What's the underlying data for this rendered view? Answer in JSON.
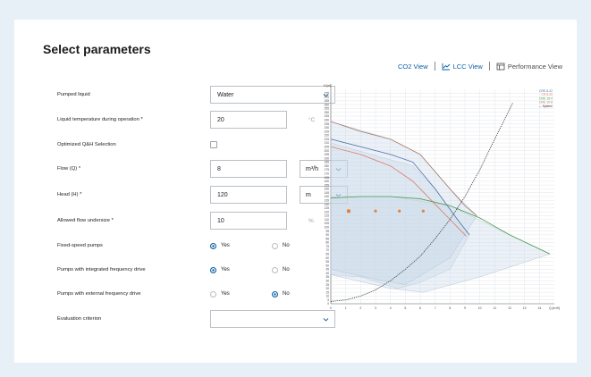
{
  "page": {
    "title": "Select parameters"
  },
  "views": [
    {
      "label": "CO2 View",
      "icon": ""
    },
    {
      "label": "LCC View",
      "icon": "line-chart-icon"
    },
    {
      "label": "Performance View",
      "icon": "performance-icon"
    }
  ],
  "form": {
    "pumped_liquid": {
      "label": "Pumped liquid",
      "value": "Water"
    },
    "liquid_temp": {
      "label": "Liquid temperature during operation *",
      "value": "20",
      "unit": "°C"
    },
    "optimized": {
      "label": "Optimized Q&H Selection",
      "checked": false
    },
    "flow": {
      "label": "Flow (Q) *",
      "value": "8",
      "unit": "m³/h"
    },
    "head": {
      "label": "Head (H) *",
      "value": "120",
      "unit": "m"
    },
    "undersize": {
      "label": "Allowed flow undersize *",
      "value": "10",
      "unit": "%"
    },
    "fixed_speed": {
      "label": "Fixed-speed pumps",
      "yes": "Yes",
      "no": "No",
      "selected": "Yes"
    },
    "integrated_freq": {
      "label": "Pumps with integrated frequency drive",
      "yes": "Yes",
      "no": "No",
      "selected": "Yes"
    },
    "external_freq": {
      "label": "Pumps with external frequency drive",
      "yes": "Yes",
      "no": "No",
      "selected": "No"
    },
    "evaluation": {
      "label": "Evaluation criterion",
      "value": ""
    }
  },
  "colors": {
    "accent": "#0b5fa5",
    "background": "#e8f0f7"
  },
  "chart_data": {
    "type": "line",
    "xlabel": "Q [m³/h]",
    "ylabel": "H [m]",
    "xlim": [
      0,
      15
    ],
    "ylim": [
      0,
      280
    ],
    "x_ticks": [
      0,
      1,
      2,
      3,
      4,
      5,
      6,
      7,
      8,
      9,
      10,
      11,
      12,
      13,
      14
    ],
    "y_ticks": [
      0,
      5,
      10,
      15,
      20,
      25,
      30,
      35,
      40,
      45,
      50,
      55,
      60,
      65,
      70,
      75,
      80,
      85,
      90,
      95,
      100,
      105,
      110,
      115,
      120,
      125,
      130,
      135,
      140,
      145,
      150,
      155,
      160,
      165,
      170,
      175,
      180,
      185,
      190,
      195,
      200,
      205,
      210,
      215,
      220,
      225,
      230,
      235,
      240,
      245,
      250,
      255,
      260,
      265,
      270,
      275
    ],
    "grid": true,
    "legend_position": "top-right",
    "series": [
      {
        "name": "CRE 8-22",
        "color": "#4a6fa5",
        "x": [
          0,
          2,
          4,
          5.5,
          7,
          8.5,
          9.3
        ],
        "y": [
          215,
          205,
          195,
          185,
          150,
          110,
          90
        ]
      },
      {
        "name": "CR 8-20",
        "color": "#e07a6a",
        "x": [
          0,
          2,
          4,
          5.5,
          7,
          8.5,
          9.1
        ],
        "y": [
          205,
          195,
          180,
          160,
          130,
          100,
          88
        ]
      },
      {
        "name": "CRE 15-4",
        "color": "#4a9a4a",
        "x": [
          0,
          2,
          4,
          6,
          8,
          10,
          12,
          14.7
        ],
        "y": [
          138,
          140,
          140,
          137,
          128,
          112,
          90,
          65
        ]
      },
      {
        "name": "CRE 10-8",
        "color": "#a87a6a",
        "x": [
          0,
          2,
          4,
          6,
          8,
          9,
          9.8
        ],
        "y": [
          238,
          225,
          215,
          195,
          150,
          128,
          115
        ]
      },
      {
        "name": "System",
        "color": "#333333",
        "x": [
          0,
          1,
          2,
          3,
          4,
          5,
          6,
          7,
          8,
          9,
          10,
          11,
          12.2
        ],
        "y": [
          3,
          5,
          10,
          18,
          30,
          45,
          62,
          85,
          110,
          140,
          175,
          215,
          262
        ]
      }
    ],
    "points": [
      {
        "x": 1.2,
        "y": 121
      },
      {
        "x": 3,
        "y": 121
      },
      {
        "x": 4.6,
        "y": 121
      },
      {
        "x": 6.2,
        "y": 121
      }
    ]
  }
}
